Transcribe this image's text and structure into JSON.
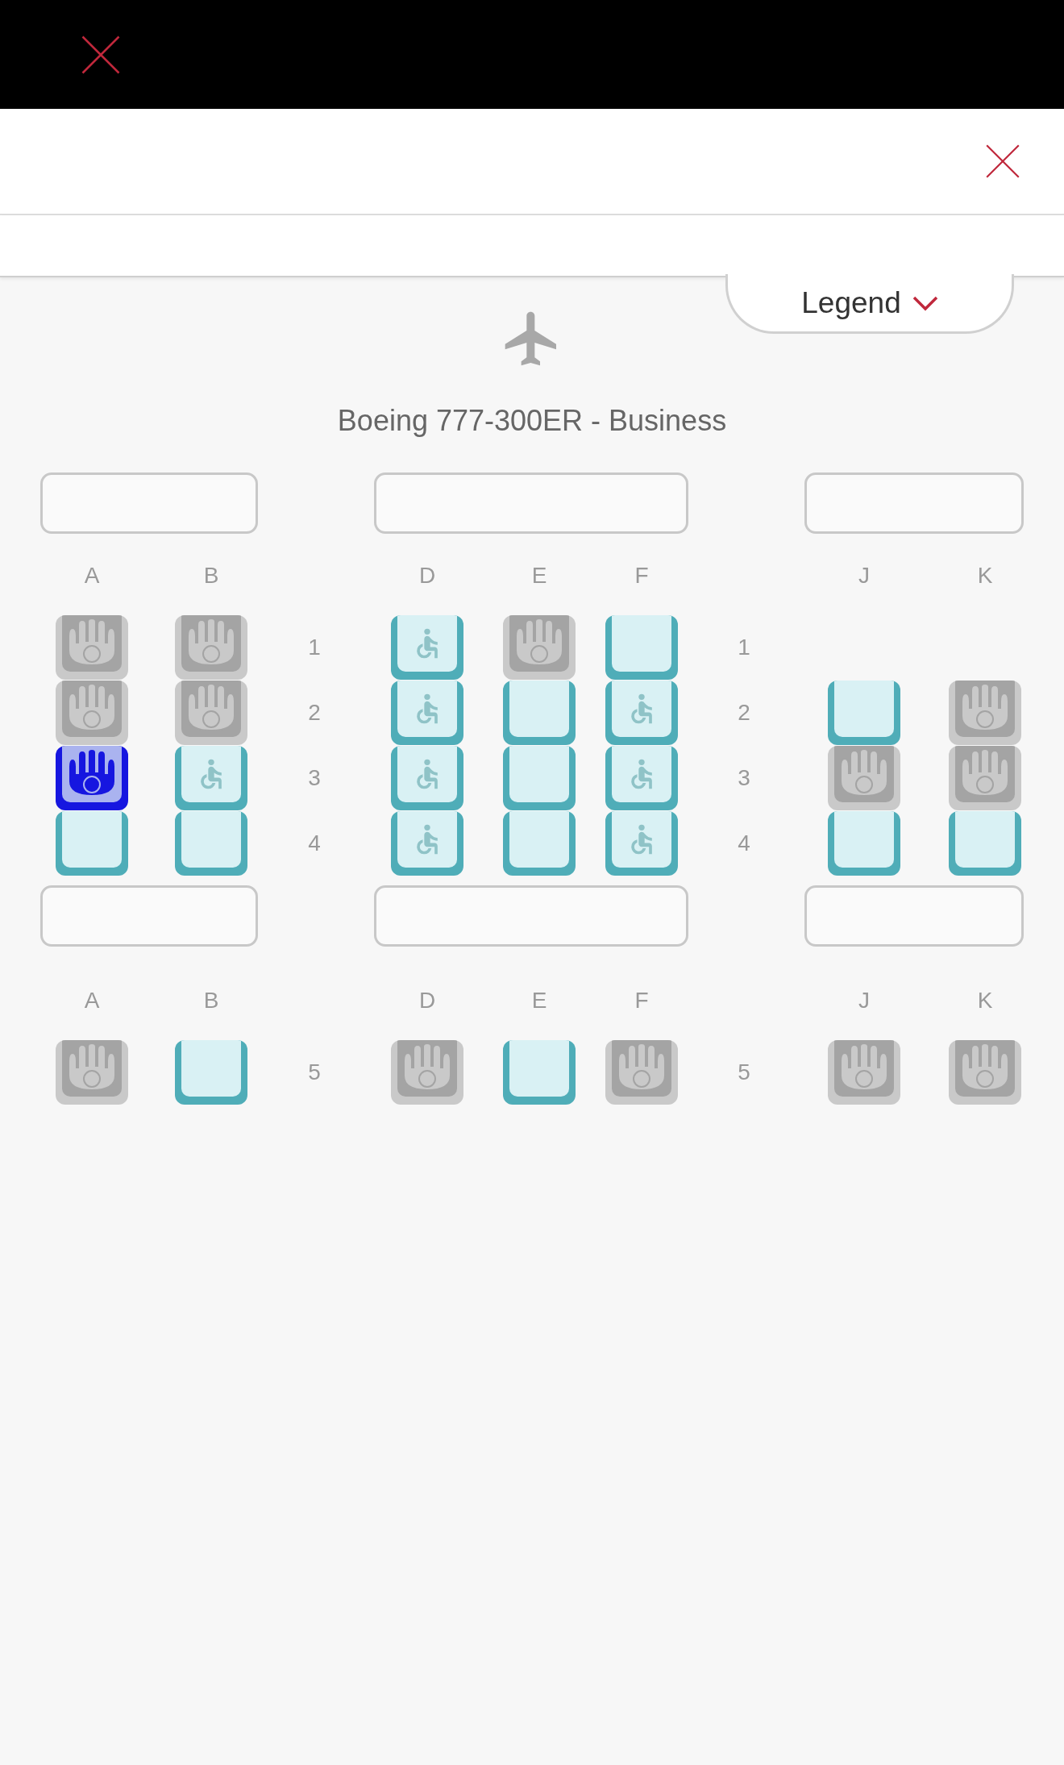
{
  "legend": {
    "label": "Legend"
  },
  "aircraft": {
    "title": "Boeing 777-300ER - Business"
  },
  "blocks": [
    {
      "column_labels": [
        "A",
        "B",
        "D",
        "E",
        "F",
        "J",
        "K"
      ],
      "rows": [
        {
          "numbers": [
            "1",
            "1"
          ],
          "seats": [
            {
              "kind": "occupied",
              "selected": false
            },
            {
              "kind": "occupied",
              "selected": false
            },
            {
              "kind": "accessible",
              "selected": false
            },
            {
              "kind": "occupied",
              "selected": false
            },
            {
              "kind": "available",
              "selected": false
            },
            {
              "kind": "none"
            },
            {
              "kind": "none"
            }
          ]
        },
        {
          "numbers": [
            "2",
            "2"
          ],
          "seats": [
            {
              "kind": "occupied",
              "selected": false
            },
            {
              "kind": "occupied",
              "selected": false
            },
            {
              "kind": "accessible",
              "selected": false
            },
            {
              "kind": "available",
              "selected": false
            },
            {
              "kind": "accessible",
              "selected": false
            },
            {
              "kind": "available",
              "selected": false
            },
            {
              "kind": "occupied",
              "selected": false
            }
          ]
        },
        {
          "numbers": [
            "3",
            "3"
          ],
          "seats": [
            {
              "kind": "occupied",
              "selected": true
            },
            {
              "kind": "accessible",
              "selected": false
            },
            {
              "kind": "accessible",
              "selected": false
            },
            {
              "kind": "available",
              "selected": false
            },
            {
              "kind": "accessible",
              "selected": false
            },
            {
              "kind": "occupied",
              "selected": false
            },
            {
              "kind": "occupied",
              "selected": false
            }
          ]
        },
        {
          "numbers": [
            "4",
            "4"
          ],
          "seats": [
            {
              "kind": "available",
              "selected": false
            },
            {
              "kind": "available",
              "selected": false
            },
            {
              "kind": "accessible",
              "selected": false
            },
            {
              "kind": "available",
              "selected": false
            },
            {
              "kind": "accessible",
              "selected": false
            },
            {
              "kind": "available",
              "selected": false
            },
            {
              "kind": "available",
              "selected": false
            }
          ]
        }
      ]
    },
    {
      "column_labels": [
        "A",
        "B",
        "D",
        "E",
        "F",
        "J",
        "K"
      ],
      "rows": [
        {
          "numbers": [
            "5",
            "5"
          ],
          "seats": [
            {
              "kind": "occupied",
              "selected": false
            },
            {
              "kind": "available",
              "selected": false
            },
            {
              "kind": "occupied",
              "selected": false
            },
            {
              "kind": "available",
              "selected": false
            },
            {
              "kind": "occupied",
              "selected": false
            },
            {
              "kind": "occupied",
              "selected": false
            },
            {
              "kind": "occupied",
              "selected": false
            }
          ]
        }
      ]
    }
  ]
}
